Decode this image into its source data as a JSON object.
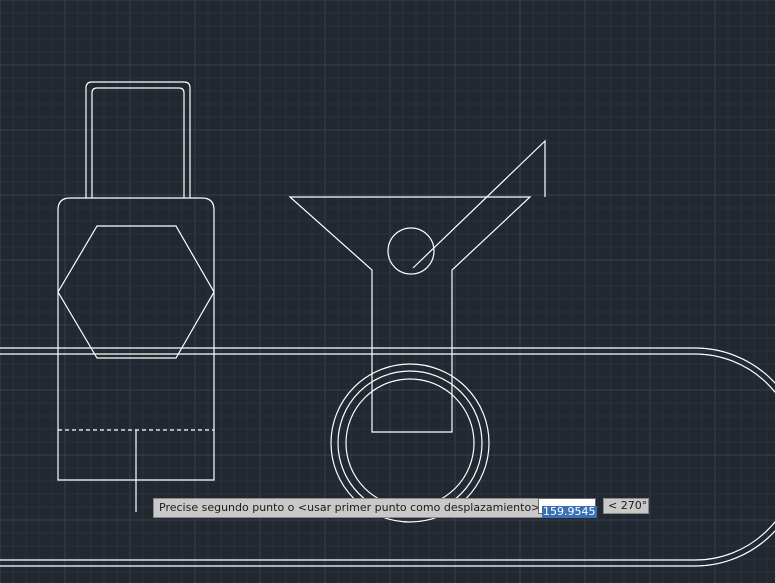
{
  "command_prompt": {
    "text": "Precise segundo punto o <usar primer punto como desplazamiento>:",
    "distance_value": "159.9545",
    "angle_value": "< 270°"
  },
  "colors": {
    "background": "#212830",
    "grid_minor": "#2a3240",
    "grid_major": "#374152",
    "geometry": "#ffffff"
  }
}
